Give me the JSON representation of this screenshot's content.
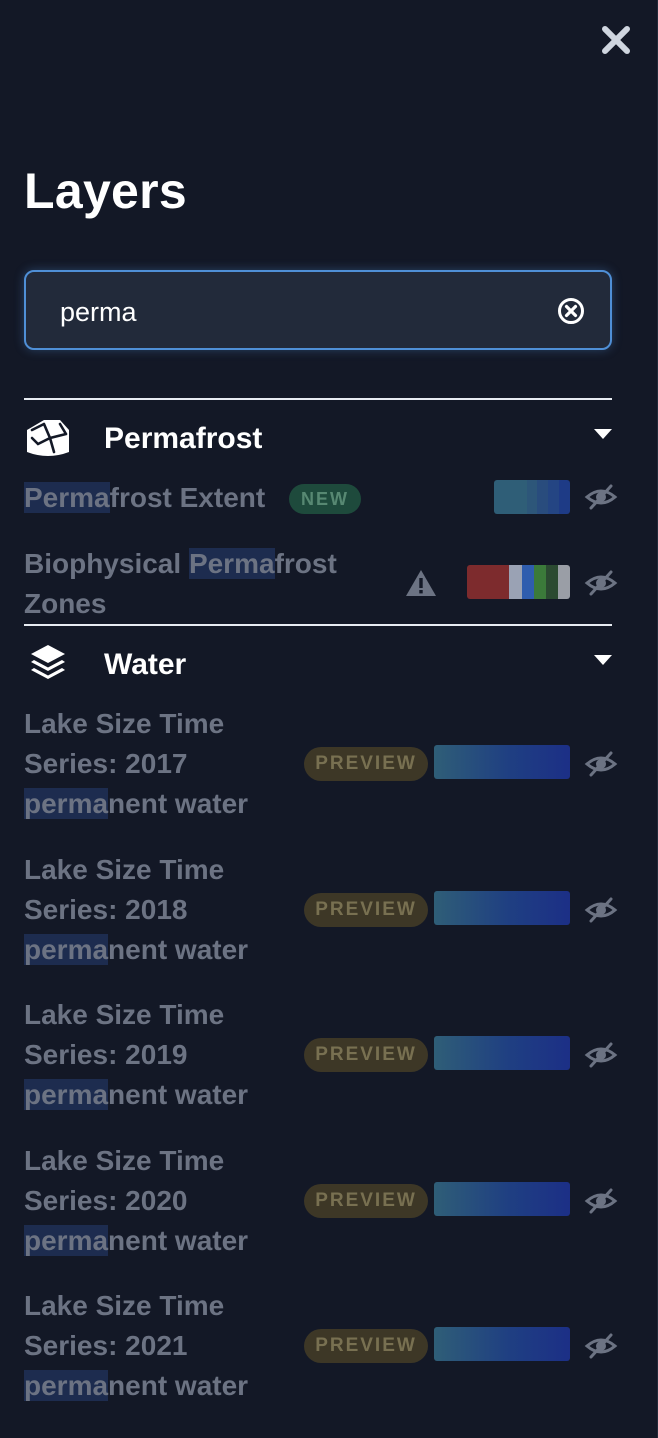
{
  "panel": {
    "title": "Layers",
    "close_icon": "close-icon"
  },
  "search": {
    "value": "perma",
    "clear_icon": "clear-circle-icon"
  },
  "categories": [
    {
      "label": "Permafrost",
      "icon": "permafrost-icon",
      "layers": [
        {
          "name_parts": [
            "",
            "Perma",
            "frost Extent"
          ],
          "badge": "NEW",
          "legend": [
            "#2f5e77",
            "#2d5679",
            "#294c7d",
            "#244583",
            "#1e3b86"
          ]
        },
        {
          "name_parts": [
            "Biophysical ",
            "Perma",
            "frost"
          ],
          "name_line2": "Zones",
          "warning_icon": "warning-icon",
          "legend": [
            "#7d2b2d",
            "#9aa2b4",
            "#2f5dae",
            "#3b7a3a",
            "#2b4a31",
            "#9a9ea6"
          ]
        }
      ]
    },
    {
      "label": "Water",
      "icon": "layers-stack-icon",
      "layers": [
        {
          "line1": "Lake Size Time",
          "line2": "Series: 2017",
          "hl": "perma",
          "rest": "nent water",
          "badge": "PREVIEW"
        },
        {
          "line1": "Lake Size Time",
          "line2": "Series: 2018",
          "hl": "perma",
          "rest": "nent water",
          "badge": "PREVIEW"
        },
        {
          "line1": "Lake Size Time",
          "line2": "Series: 2019",
          "hl": "perma",
          "rest": "nent water",
          "badge": "PREVIEW"
        },
        {
          "line1": "Lake Size Time",
          "line2": "Series: 2020",
          "hl": "perma",
          "rest": "nent water",
          "badge": "PREVIEW"
        },
        {
          "line1": "Lake Size Time",
          "line2": "Series: 2021",
          "hl": "perma",
          "rest": "nent water",
          "badge": "PREVIEW"
        }
      ]
    }
  ],
  "colors": {
    "background": "#131826",
    "accent": "#4f8fd6",
    "highlight": "#1d2c4f",
    "muted_text": "#6c7383",
    "new_badge": "#1e4a3c",
    "preview_badge": "#3d3726"
  }
}
